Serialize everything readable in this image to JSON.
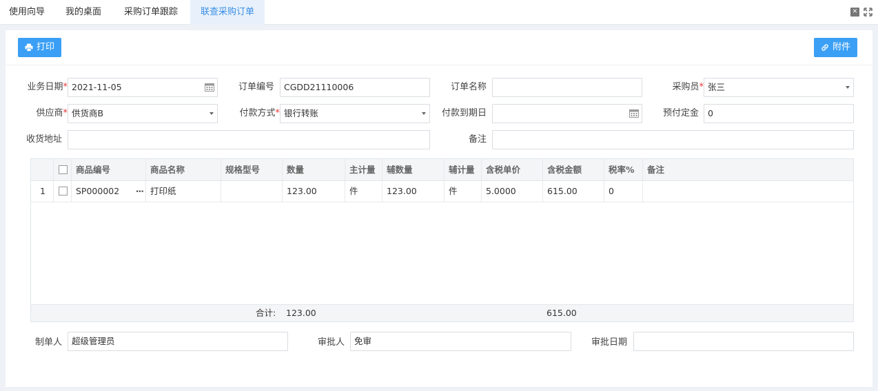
{
  "tabs": [
    {
      "label": "使用向导"
    },
    {
      "label": "我的桌面"
    },
    {
      "label": "采购订单跟踪"
    },
    {
      "label": "联查采购订单"
    }
  ],
  "toolbar": {
    "print_label": "打印",
    "attach_label": "附件"
  },
  "form": {
    "biz_date": {
      "label": "业务日期",
      "value": "2021-11-05"
    },
    "order_no": {
      "label": "订单编号",
      "value": "CGDD21110006"
    },
    "order_name": {
      "label": "订单名称",
      "value": ""
    },
    "buyer": {
      "label": "采购员",
      "value": "张三"
    },
    "supplier": {
      "label": "供应商",
      "value": "供货商B"
    },
    "pay_method": {
      "label": "付款方式",
      "value": "银行转账"
    },
    "pay_due": {
      "label": "付款到期日",
      "value": ""
    },
    "deposit": {
      "label": "预付定金",
      "value": "0"
    },
    "address": {
      "label": "收货地址",
      "value": ""
    },
    "remark": {
      "label": "备注",
      "value": ""
    }
  },
  "grid": {
    "columns": [
      "商品编号",
      "商品名称",
      "规格型号",
      "数量",
      "主计量",
      "辅数量",
      "辅计量",
      "含税单价",
      "含税金额",
      "税率%",
      "备注"
    ],
    "rows": [
      {
        "idx": "1",
        "code": "SP000002",
        "name": "打印纸",
        "spec": "",
        "qty": "123.00",
        "unit": "件",
        "aux_qty": "123.00",
        "aux_unit": "件",
        "price": "5.0000",
        "amount": "615.00",
        "tax": "0",
        "note": ""
      }
    ],
    "footer": {
      "label": "合计:",
      "qty": "123.00",
      "amount": "615.00"
    }
  },
  "bottom": {
    "maker": {
      "label": "制单人",
      "value": "超级管理员"
    },
    "approver": {
      "label": "审批人",
      "value": "免审"
    },
    "approve_date": {
      "label": "审批日期",
      "value": ""
    }
  },
  "colors": {
    "accent": "#3a9ff5",
    "active_tab": "#3a8ee6",
    "required": "#e33333"
  }
}
